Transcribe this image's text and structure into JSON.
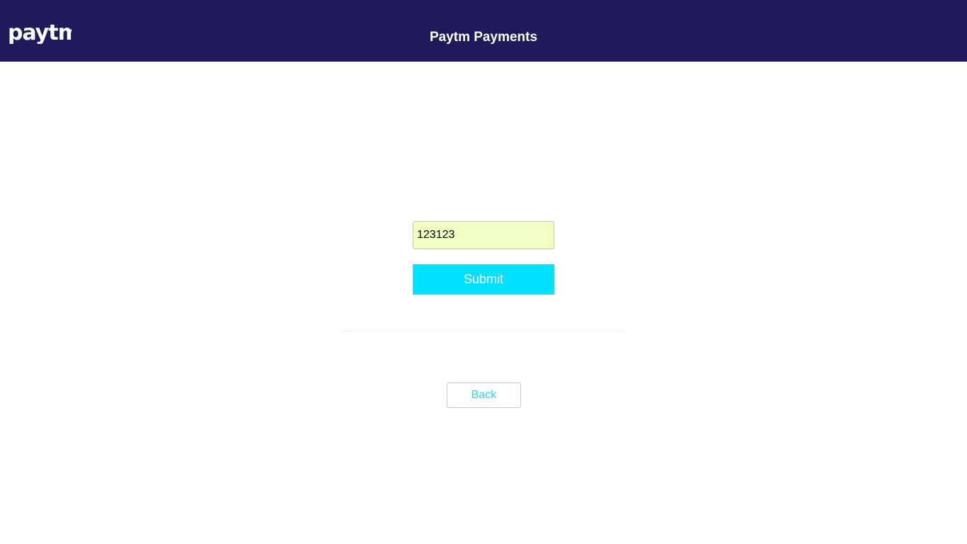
{
  "header": {
    "logo_text": "paytm",
    "title": "Paytm Payments"
  },
  "form": {
    "otp_value": "123123",
    "submit_label": "Submit",
    "back_label": "Back"
  },
  "colors": {
    "header_bg": "#201a5a",
    "input_bg": "#f2ffc2",
    "submit_bg": "#00e0ff",
    "back_text": "#1fd8f0"
  }
}
